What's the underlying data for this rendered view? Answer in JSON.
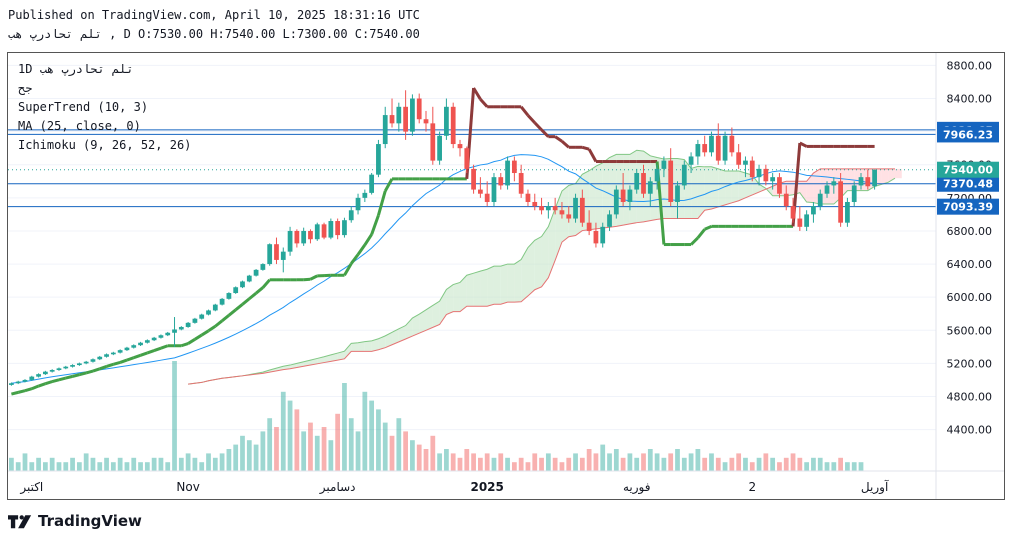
{
  "header": {
    "published": "Published on TradingView.com, April 10, 2025 18:31:16 UTC",
    "symbol_line": "تلم تحادرپ هب , D O:7530.00 H:7540.00 L:7300.00 C:7540.00"
  },
  "legend": {
    "symbol": "1D تلم تحادرپ هب",
    "sub": "جح",
    "supertrend": "SuperTrend (10, 3)",
    "ma": "MA (25, close, 0)",
    "ichimoku": "Ichimoku (9, 26, 52, 26)"
  },
  "footer": {
    "brand": "TradingView"
  },
  "colors": {
    "up": "#26a69a",
    "down": "#ef5350",
    "supertrend_up": "#43a047",
    "supertrend_down": "#8d3a3a",
    "ma": "#2196f3",
    "cloud_bull": "#c8e6c9",
    "cloud_bear": "#ffcdd2",
    "hline": "#1565c0",
    "badge": "#1565c0",
    "last_price": "#26a69a"
  },
  "chart_data": {
    "type": "candlestick",
    "y_range": [
      3900,
      8950
    ],
    "y_ticks": [
      "8800.00",
      "8400.00",
      "8000.00",
      "7600.00",
      "7200.00",
      "6800.00",
      "6400.00",
      "6000.00",
      "5600.00",
      "5200.00",
      "4800.00",
      "4400.00"
    ],
    "x_labels": [
      {
        "label": "اکتبر",
        "t": 3,
        "bold": false
      },
      {
        "label": "Nov",
        "t": 26,
        "bold": false
      },
      {
        "label": "دسامبر",
        "t": 48,
        "bold": false
      },
      {
        "label": "2025",
        "t": 70,
        "bold": true
      },
      {
        "label": "فوریه",
        "t": 92,
        "bold": false
      },
      {
        "label": "2",
        "t": 109,
        "bold": false
      },
      {
        "label": "آوریل",
        "t": 127,
        "bold": false
      }
    ],
    "price_levels": [
      {
        "label": "8021.65",
        "value": 8021.65
      },
      {
        "label": "7966.23",
        "value": 7966.23
      },
      {
        "label": "7370.48",
        "value": 7370.48
      },
      {
        "label": "7093.39",
        "value": 7093.39
      }
    ],
    "last_price": {
      "label": "7540.00",
      "value": 7540
    },
    "candles": [
      [
        4940,
        4970,
        4930,
        4960
      ],
      [
        4960,
        4990,
        4950,
        4980
      ],
      [
        4980,
        5010,
        4970,
        5000
      ],
      [
        5000,
        5050,
        4990,
        5040
      ],
      [
        5040,
        5080,
        5030,
        5070
      ],
      [
        5070,
        5110,
        5060,
        5100
      ],
      [
        5100,
        5130,
        5090,
        5120
      ],
      [
        5120,
        5150,
        5110,
        5140
      ],
      [
        5140,
        5170,
        5130,
        5160
      ],
      [
        5160,
        5190,
        5150,
        5180
      ],
      [
        5180,
        5210,
        5170,
        5200
      ],
      [
        5200,
        5230,
        5190,
        5220
      ],
      [
        5220,
        5260,
        5210,
        5250
      ],
      [
        5250,
        5290,
        5240,
        5280
      ],
      [
        5280,
        5320,
        5270,
        5310
      ],
      [
        5310,
        5340,
        5300,
        5330
      ],
      [
        5330,
        5370,
        5320,
        5360
      ],
      [
        5360,
        5400,
        5350,
        5390
      ],
      [
        5390,
        5430,
        5380,
        5420
      ],
      [
        5420,
        5460,
        5410,
        5450
      ],
      [
        5450,
        5490,
        5440,
        5480
      ],
      [
        5480,
        5520,
        5470,
        5510
      ],
      [
        5510,
        5550,
        5500,
        5540
      ],
      [
        5540,
        5580,
        5530,
        5570
      ],
      [
        5570,
        5760,
        5400,
        5610
      ],
      [
        5610,
        5650,
        5600,
        5640
      ],
      [
        5640,
        5700,
        5630,
        5690
      ],
      [
        5690,
        5750,
        5680,
        5740
      ],
      [
        5740,
        5800,
        5730,
        5790
      ],
      [
        5790,
        5850,
        5780,
        5840
      ],
      [
        5840,
        5920,
        5830,
        5910
      ],
      [
        5910,
        5990,
        5900,
        5980
      ],
      [
        5980,
        6060,
        5970,
        6050
      ],
      [
        6050,
        6130,
        6040,
        6120
      ],
      [
        6120,
        6200,
        6110,
        6190
      ],
      [
        6190,
        6270,
        6180,
        6260
      ],
      [
        6260,
        6340,
        6250,
        6330
      ],
      [
        6330,
        6410,
        6320,
        6400
      ],
      [
        6400,
        6650,
        6380,
        6640
      ],
      [
        6640,
        6720,
        6400,
        6450
      ],
      [
        6450,
        6600,
        6300,
        6550
      ],
      [
        6550,
        6850,
        6500,
        6800
      ],
      [
        6800,
        6820,
        6600,
        6650
      ],
      [
        6650,
        6840,
        6620,
        6800
      ],
      [
        6800,
        6820,
        6650,
        6700
      ],
      [
        6700,
        6900,
        6680,
        6880
      ],
      [
        6880,
        6900,
        6700,
        6720
      ],
      [
        6720,
        6950,
        6700,
        6920
      ],
      [
        6920,
        6950,
        6700,
        6750
      ],
      [
        6750,
        6960,
        6720,
        6930
      ],
      [
        6930,
        7100,
        6900,
        7050
      ],
      [
        7050,
        7250,
        7000,
        7200
      ],
      [
        7200,
        7300,
        7150,
        7260
      ],
      [
        7260,
        7500,
        7240,
        7480
      ],
      [
        7480,
        7900,
        7450,
        7850
      ],
      [
        7850,
        8300,
        7800,
        8200
      ],
      [
        8200,
        8400,
        8050,
        8100
      ],
      [
        8100,
        8350,
        8000,
        8300
      ],
      [
        8300,
        8500,
        7900,
        8000
      ],
      [
        8000,
        8450,
        7950,
        8400
      ],
      [
        8400,
        8460,
        8100,
        8150
      ],
      [
        8150,
        8250,
        8000,
        8100
      ],
      [
        8100,
        8300,
        7600,
        7650
      ],
      [
        7650,
        8000,
        7600,
        7950
      ],
      [
        7950,
        8400,
        7900,
        8300
      ],
      [
        8300,
        8350,
        7800,
        7850
      ],
      [
        7850,
        7900,
        7700,
        7800
      ],
      [
        7800,
        7820,
        7500,
        7550
      ],
      [
        7550,
        7600,
        7250,
        7300
      ],
      [
        7300,
        7450,
        7200,
        7250
      ],
      [
        7250,
        7400,
        7100,
        7150
      ],
      [
        7150,
        7500,
        7100,
        7450
      ],
      [
        7450,
        7500,
        7300,
        7350
      ],
      [
        7350,
        7700,
        7300,
        7650
      ],
      [
        7650,
        7700,
        7400,
        7500
      ],
      [
        7500,
        7600,
        7200,
        7250
      ],
      [
        7250,
        7300,
        7100,
        7150
      ],
      [
        7150,
        7250,
        7050,
        7100
      ],
      [
        7100,
        7200,
        7000,
        7050
      ],
      [
        7050,
        7150,
        6950,
        7100
      ],
      [
        7100,
        7200,
        7000,
        7050
      ],
      [
        7050,
        7150,
        6950,
        7000
      ],
      [
        7000,
        7100,
        6900,
        6950
      ],
      [
        6950,
        7250,
        6900,
        7200
      ],
      [
        7200,
        7300,
        6850,
        6900
      ],
      [
        6900,
        7050,
        6750,
        6800
      ],
      [
        6800,
        6900,
        6600,
        6650
      ],
      [
        6650,
        6900,
        6600,
        6850
      ],
      [
        6850,
        7050,
        6800,
        7000
      ],
      [
        7000,
        7350,
        6950,
        7300
      ],
      [
        7300,
        7500,
        7100,
        7150
      ],
      [
        7150,
        7350,
        7050,
        7300
      ],
      [
        7300,
        7550,
        7250,
        7500
      ],
      [
        7500,
        7600,
        7200,
        7250
      ],
      [
        7250,
        7450,
        7100,
        7400
      ],
      [
        7400,
        7600,
        7300,
        7550
      ],
      [
        7550,
        7700,
        7450,
        7650
      ],
      [
        7650,
        7800,
        7100,
        7150
      ],
      [
        7150,
        7400,
        6950,
        7350
      ],
      [
        7350,
        7650,
        7300,
        7600
      ],
      [
        7600,
        7750,
        7500,
        7700
      ],
      [
        7700,
        7900,
        7600,
        7850
      ],
      [
        7850,
        7950,
        7700,
        7750
      ],
      [
        7750,
        8000,
        7700,
        7950
      ],
      [
        7950,
        8100,
        7600,
        7650
      ],
      [
        7650,
        8000,
        7600,
        7950
      ],
      [
        7950,
        8050,
        7700,
        7750
      ],
      [
        7750,
        7850,
        7550,
        7600
      ],
      [
        7600,
        7700,
        7450,
        7650
      ],
      [
        7650,
        7700,
        7400,
        7450
      ],
      [
        7450,
        7600,
        7350,
        7550
      ],
      [
        7550,
        7600,
        7350,
        7400
      ],
      [
        7400,
        7500,
        7300,
        7450
      ],
      [
        7450,
        7500,
        7200,
        7250
      ],
      [
        7250,
        7350,
        7050,
        7100
      ],
      [
        7100,
        7200,
        6900,
        6950
      ],
      [
        6950,
        7100,
        6800,
        6850
      ],
      [
        6850,
        7050,
        6800,
        7000
      ],
      [
        7000,
        7150,
        6900,
        7100
      ],
      [
        7100,
        7300,
        7050,
        7250
      ],
      [
        7250,
        7400,
        7200,
        7350
      ],
      [
        7350,
        7450,
        7250,
        7400
      ],
      [
        7400,
        7500,
        6850,
        6900
      ],
      [
        6900,
        7200,
        6850,
        7150
      ],
      [
        7150,
        7400,
        7100,
        7350
      ],
      [
        7350,
        7500,
        7300,
        7450
      ],
      [
        7450,
        7540,
        7300,
        7340
      ],
      [
        7340,
        7540,
        7300,
        7540
      ]
    ],
    "volume": [
      3,
      2,
      4,
      2,
      3,
      2,
      3,
      2,
      2,
      3,
      2,
      4,
      3,
      2,
      3,
      2,
      3,
      2,
      3,
      2,
      2,
      3,
      3,
      2,
      25,
      3,
      4,
      3,
      2,
      4,
      3,
      4,
      5,
      6,
      8,
      7,
      6,
      9,
      12,
      10,
      18,
      16,
      14,
      9,
      11,
      8,
      10,
      7,
      13,
      20,
      12,
      9,
      18,
      16,
      14,
      11,
      8,
      12,
      9,
      7,
      6,
      5,
      8,
      4,
      5,
      4,
      3,
      5,
      4,
      3,
      4,
      3,
      4,
      3,
      2,
      3,
      2,
      4,
      3,
      4,
      3,
      2,
      3,
      4,
      3,
      5,
      4,
      6,
      4,
      5,
      3,
      4,
      3,
      4,
      5,
      4,
      3,
      4,
      5,
      3,
      4,
      5,
      3,
      4,
      3,
      2,
      3,
      4,
      3,
      2,
      3,
      4,
      3,
      2,
      3,
      4,
      3,
      2,
      3,
      3,
      2,
      2,
      3,
      2,
      2,
      2
    ]
  }
}
